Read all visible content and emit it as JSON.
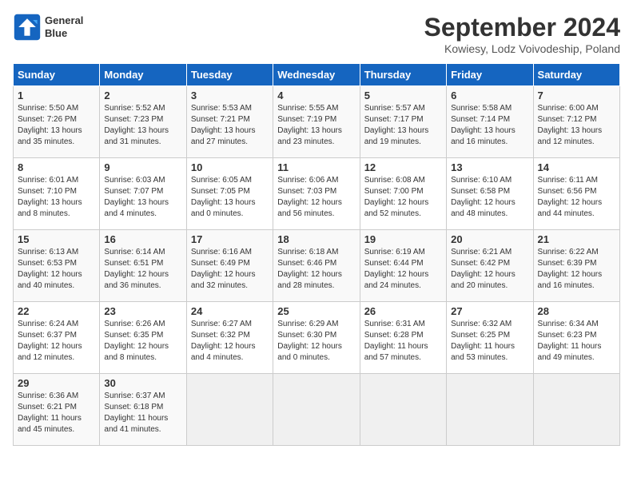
{
  "header": {
    "logo_line1": "General",
    "logo_line2": "Blue",
    "month": "September 2024",
    "location": "Kowiesy, Lodz Voivodeship, Poland"
  },
  "weekdays": [
    "Sunday",
    "Monday",
    "Tuesday",
    "Wednesday",
    "Thursday",
    "Friday",
    "Saturday"
  ],
  "weeks": [
    [
      {
        "day": "1",
        "info": "Sunrise: 5:50 AM\nSunset: 7:26 PM\nDaylight: 13 hours\nand 35 minutes."
      },
      {
        "day": "2",
        "info": "Sunrise: 5:52 AM\nSunset: 7:23 PM\nDaylight: 13 hours\nand 31 minutes."
      },
      {
        "day": "3",
        "info": "Sunrise: 5:53 AM\nSunset: 7:21 PM\nDaylight: 13 hours\nand 27 minutes."
      },
      {
        "day": "4",
        "info": "Sunrise: 5:55 AM\nSunset: 7:19 PM\nDaylight: 13 hours\nand 23 minutes."
      },
      {
        "day": "5",
        "info": "Sunrise: 5:57 AM\nSunset: 7:17 PM\nDaylight: 13 hours\nand 19 minutes."
      },
      {
        "day": "6",
        "info": "Sunrise: 5:58 AM\nSunset: 7:14 PM\nDaylight: 13 hours\nand 16 minutes."
      },
      {
        "day": "7",
        "info": "Sunrise: 6:00 AM\nSunset: 7:12 PM\nDaylight: 13 hours\nand 12 minutes."
      }
    ],
    [
      {
        "day": "8",
        "info": "Sunrise: 6:01 AM\nSunset: 7:10 PM\nDaylight: 13 hours\nand 8 minutes."
      },
      {
        "day": "9",
        "info": "Sunrise: 6:03 AM\nSunset: 7:07 PM\nDaylight: 13 hours\nand 4 minutes."
      },
      {
        "day": "10",
        "info": "Sunrise: 6:05 AM\nSunset: 7:05 PM\nDaylight: 13 hours\nand 0 minutes."
      },
      {
        "day": "11",
        "info": "Sunrise: 6:06 AM\nSunset: 7:03 PM\nDaylight: 12 hours\nand 56 minutes."
      },
      {
        "day": "12",
        "info": "Sunrise: 6:08 AM\nSunset: 7:00 PM\nDaylight: 12 hours\nand 52 minutes."
      },
      {
        "day": "13",
        "info": "Sunrise: 6:10 AM\nSunset: 6:58 PM\nDaylight: 12 hours\nand 48 minutes."
      },
      {
        "day": "14",
        "info": "Sunrise: 6:11 AM\nSunset: 6:56 PM\nDaylight: 12 hours\nand 44 minutes."
      }
    ],
    [
      {
        "day": "15",
        "info": "Sunrise: 6:13 AM\nSunset: 6:53 PM\nDaylight: 12 hours\nand 40 minutes."
      },
      {
        "day": "16",
        "info": "Sunrise: 6:14 AM\nSunset: 6:51 PM\nDaylight: 12 hours\nand 36 minutes."
      },
      {
        "day": "17",
        "info": "Sunrise: 6:16 AM\nSunset: 6:49 PM\nDaylight: 12 hours\nand 32 minutes."
      },
      {
        "day": "18",
        "info": "Sunrise: 6:18 AM\nSunset: 6:46 PM\nDaylight: 12 hours\nand 28 minutes."
      },
      {
        "day": "19",
        "info": "Sunrise: 6:19 AM\nSunset: 6:44 PM\nDaylight: 12 hours\nand 24 minutes."
      },
      {
        "day": "20",
        "info": "Sunrise: 6:21 AM\nSunset: 6:42 PM\nDaylight: 12 hours\nand 20 minutes."
      },
      {
        "day": "21",
        "info": "Sunrise: 6:22 AM\nSunset: 6:39 PM\nDaylight: 12 hours\nand 16 minutes."
      }
    ],
    [
      {
        "day": "22",
        "info": "Sunrise: 6:24 AM\nSunset: 6:37 PM\nDaylight: 12 hours\nand 12 minutes."
      },
      {
        "day": "23",
        "info": "Sunrise: 6:26 AM\nSunset: 6:35 PM\nDaylight: 12 hours\nand 8 minutes."
      },
      {
        "day": "24",
        "info": "Sunrise: 6:27 AM\nSunset: 6:32 PM\nDaylight: 12 hours\nand 4 minutes."
      },
      {
        "day": "25",
        "info": "Sunrise: 6:29 AM\nSunset: 6:30 PM\nDaylight: 12 hours\nand 0 minutes."
      },
      {
        "day": "26",
        "info": "Sunrise: 6:31 AM\nSunset: 6:28 PM\nDaylight: 11 hours\nand 57 minutes."
      },
      {
        "day": "27",
        "info": "Sunrise: 6:32 AM\nSunset: 6:25 PM\nDaylight: 11 hours\nand 53 minutes."
      },
      {
        "day": "28",
        "info": "Sunrise: 6:34 AM\nSunset: 6:23 PM\nDaylight: 11 hours\nand 49 minutes."
      }
    ],
    [
      {
        "day": "29",
        "info": "Sunrise: 6:36 AM\nSunset: 6:21 PM\nDaylight: 11 hours\nand 45 minutes."
      },
      {
        "day": "30",
        "info": "Sunrise: 6:37 AM\nSunset: 6:18 PM\nDaylight: 11 hours\nand 41 minutes."
      },
      {
        "day": "",
        "info": ""
      },
      {
        "day": "",
        "info": ""
      },
      {
        "day": "",
        "info": ""
      },
      {
        "day": "",
        "info": ""
      },
      {
        "day": "",
        "info": ""
      }
    ]
  ]
}
